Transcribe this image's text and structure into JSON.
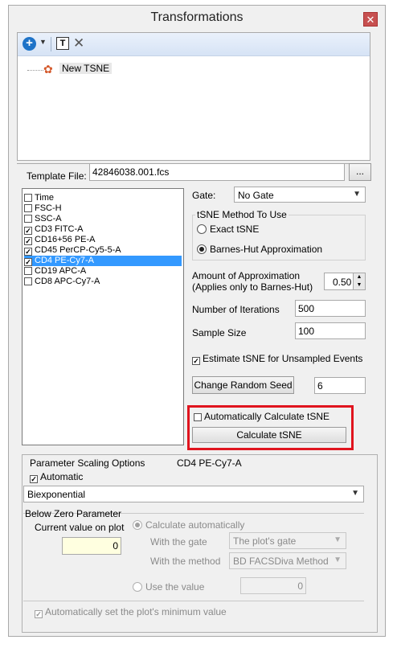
{
  "window": {
    "title": "Transformations",
    "close_glyph": "✕"
  },
  "toolbar": {
    "add_glyph": "+",
    "dropdown_glyph": "▼",
    "rename_glyph": "T",
    "delete_glyph": "✕"
  },
  "tree": {
    "items": [
      {
        "label": "New TSNE",
        "icon": "tsne-node-icon"
      }
    ]
  },
  "template": {
    "label": "Template File:",
    "value": "42846038.001.fcs",
    "browse_label": "..."
  },
  "parameters": [
    {
      "label": "Time",
      "checked": ""
    },
    {
      "label": "FSC-H",
      "checked": ""
    },
    {
      "label": "SSC-A",
      "checked": ""
    },
    {
      "label": "CD3 FITC-A",
      "checked": "✓"
    },
    {
      "label": "CD16+56 PE-A",
      "checked": "✓"
    },
    {
      "label": "CD45 PerCP-Cy5-5-A",
      "checked": "✓"
    },
    {
      "label": "CD4 PE-Cy7-A",
      "checked": "✓",
      "selected": true
    },
    {
      "label": "CD19 APC-A",
      "checked": ""
    },
    {
      "label": "CD8 APC-Cy7-A",
      "checked": ""
    }
  ],
  "gate": {
    "label": "Gate:",
    "value": "No Gate",
    "arrow": "▼"
  },
  "method": {
    "group_label": "tSNE Method To Use",
    "options": [
      {
        "label": "Exact tSNE",
        "selected": false
      },
      {
        "label": "Barnes-Hut Approximation",
        "selected": true
      }
    ]
  },
  "approx": {
    "label_line1": "Amount of Approximation",
    "label_line2": "(Applies only to Barnes-Hut)",
    "value": "0.50",
    "up": "▲",
    "down": "▼"
  },
  "iterations": {
    "label": "Number of Iterations",
    "value": "500"
  },
  "sample": {
    "label": "Sample Size",
    "value": "100"
  },
  "estimate": {
    "label": "Estimate tSNE for Unsampled Events",
    "checked": "✓"
  },
  "seed": {
    "button_label": "Change Random Seed",
    "value": "6"
  },
  "auto_calc": {
    "label": "Automatically Calculate tSNE",
    "checked": ""
  },
  "calc_button": {
    "label": "Calculate tSNE"
  },
  "scaling": {
    "options_label": "Parameter Scaling Options",
    "param_name": "CD4 PE-Cy7-A",
    "automatic_label": "Automatic",
    "automatic_checked": "✓",
    "scale_type": "Biexponential",
    "arrow": "▼"
  },
  "below_zero": {
    "group_label": "Below Zero Parameter",
    "current_label": "Current value on plot",
    "current_value": "0",
    "calc_auto_label": "Calculate automatically",
    "with_gate_label": "With the gate",
    "gate_value": "The plot's gate",
    "with_method_label": "With the method",
    "method_value": "BD FACSDiva Method",
    "use_value_label": "Use the value",
    "use_value": "0",
    "arrow": "▼"
  },
  "auto_min": {
    "label": "Automatically set the plot's minimum value",
    "checked": "✓"
  }
}
